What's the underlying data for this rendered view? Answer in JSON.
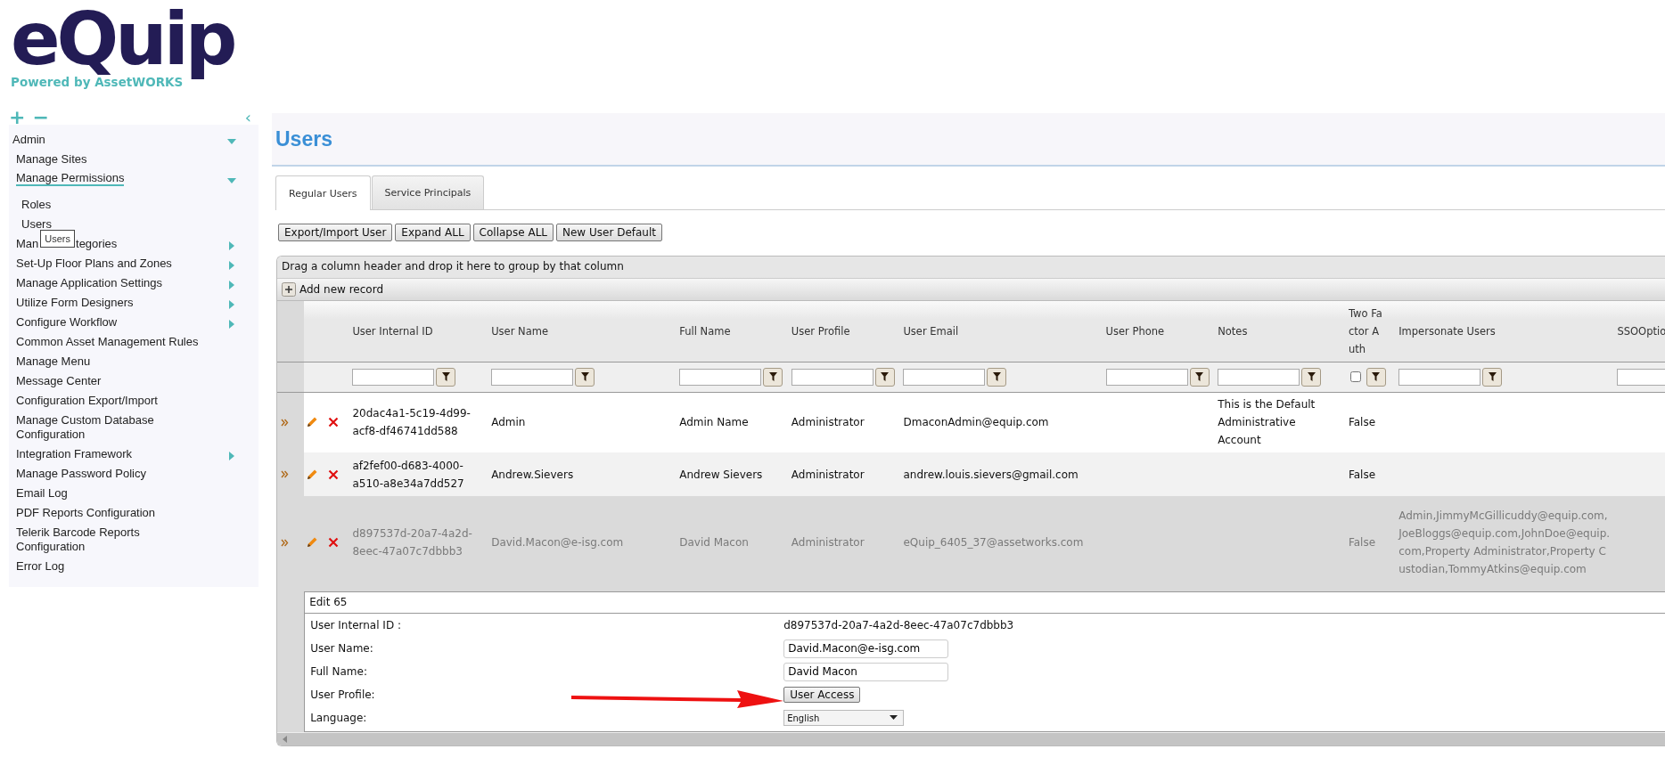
{
  "logo": {
    "name": "eQuip",
    "tagline": "Powered by AssetWORKS"
  },
  "sidebar": {
    "toolbar": {
      "expand_all": "+",
      "collapse_all": "−",
      "collapse_panel": "‹"
    },
    "items": [
      {
        "label": "Admin",
        "expanded": true,
        "selected": false,
        "children": [
          {
            "label": "Manage Sites",
            "selected": false
          },
          {
            "label": "Manage Permissions",
            "expanded": true,
            "selected": true,
            "children": [
              {
                "label": "Roles",
                "selected": false
              },
              {
                "label": "Users",
                "selected": false
              }
            ]
          },
          {
            "label": "Man",
            "label_tail": "tegories",
            "expanded": false,
            "selected": false
          },
          {
            "label": "Set-Up Floor Plans and Zones",
            "expanded": false,
            "selected": false
          },
          {
            "label": "Manage Application Settings",
            "expanded": false,
            "selected": false
          },
          {
            "label": "Utilize Form Designers",
            "expanded": false,
            "selected": false
          },
          {
            "label": "Configure Workflow",
            "expanded": false,
            "selected": false
          },
          {
            "label": "Common Asset Management Rules",
            "selected": false
          },
          {
            "label": "Manage Menu",
            "selected": false
          },
          {
            "label": "Message Center",
            "selected": false
          },
          {
            "label": "Configuration Export/Import",
            "selected": false
          },
          {
            "label": "Manage Custom Database Configuration",
            "selected": false
          },
          {
            "label": "Integration Framework",
            "expanded": false,
            "selected": false
          },
          {
            "label": "Manage Password Policy",
            "selected": false
          },
          {
            "label": "Email Log",
            "selected": false
          },
          {
            "label": "PDF Reports Configuration",
            "selected": false
          },
          {
            "label": "Telerik Barcode Reports Configuration",
            "selected": false
          },
          {
            "label": "Error Log",
            "selected": false
          }
        ]
      }
    ],
    "tooltip": "Users"
  },
  "page": {
    "title": "Users"
  },
  "tabs": [
    {
      "label": "Regular Users",
      "selected": true
    },
    {
      "label": "Service Principals",
      "selected": false
    }
  ],
  "buttons": [
    "Export/Import User",
    "Expand ALL",
    "Collapse ALL",
    "New User Default"
  ],
  "grid": {
    "group_hint": "Drag a column header and drop it here to group by that column",
    "add_record": "Add new record",
    "columns": [
      {
        "label": "User Internal ID",
        "kind": "text"
      },
      {
        "label": "User Name",
        "kind": "text"
      },
      {
        "label": "Full Name",
        "kind": "text"
      },
      {
        "label": "User Profile",
        "kind": "text"
      },
      {
        "label": "User Email",
        "kind": "text"
      },
      {
        "label": "User Phone",
        "kind": "text"
      },
      {
        "label": "Notes",
        "kind": "text"
      },
      {
        "label": "Two Factor Auth",
        "kind": "checkbox",
        "checked": false
      },
      {
        "label": "Impersonate Users",
        "kind": "text"
      },
      {
        "label": "SSOOptio",
        "kind": "field"
      }
    ],
    "rows": [
      {
        "editing": false,
        "user_internal_id": "20dac4a1-5c19-4d99-acf8-df46741dd588",
        "user_name": "Admin",
        "full_name": "Admin Name",
        "user_profile": "Administrator",
        "user_email": "DmaconAdmin@equip.com",
        "notes": "This is the Default Administrative Account",
        "two_factor_auth": "False"
      },
      {
        "editing": false,
        "user_internal_id": "af2fef00-d683-4000-a510-a8e34a7dd527",
        "user_name": "Andrew.Sievers",
        "full_name": "Andrew Sievers",
        "user_profile": "Administrator",
        "user_email": "andrew.louis.sievers@gmail.com",
        "two_factor_auth": "False"
      },
      {
        "editing": true,
        "user_internal_id": "d897537d-20a7-4a2d-8eec-47a07c7dbbb3",
        "user_name": "David.Macon@e-isg.com",
        "full_name": "David Macon",
        "user_profile": "Administrator",
        "user_email": "eQuip_6405_37@assetworks.com",
        "two_factor_auth": "False",
        "impersonate_users": "Admin,JimmyMcGillicuddy@equip.com,JoeBloggs@equip.com,JohnDoe@equip.com,Property Administrator,Property Custodian,TommyAtkins@equip.com"
      }
    ],
    "edit_form": {
      "title": "Edit 65",
      "fields": [
        {
          "kind": "text",
          "label": "User Internal ID :",
          "value": "d897537d-20a7-4a2d-8eec-47a07c7dbbb3"
        },
        {
          "kind": "input",
          "label": "User Name:",
          "value": "David.Macon@e-isg.com"
        },
        {
          "kind": "input",
          "label": "Full Name:",
          "value": "David Macon"
        },
        {
          "kind": "button",
          "label": "User Profile:",
          "value": "User Access",
          "annotated": true
        },
        {
          "kind": "select",
          "label": "Language:",
          "value": "English"
        }
      ]
    }
  }
}
